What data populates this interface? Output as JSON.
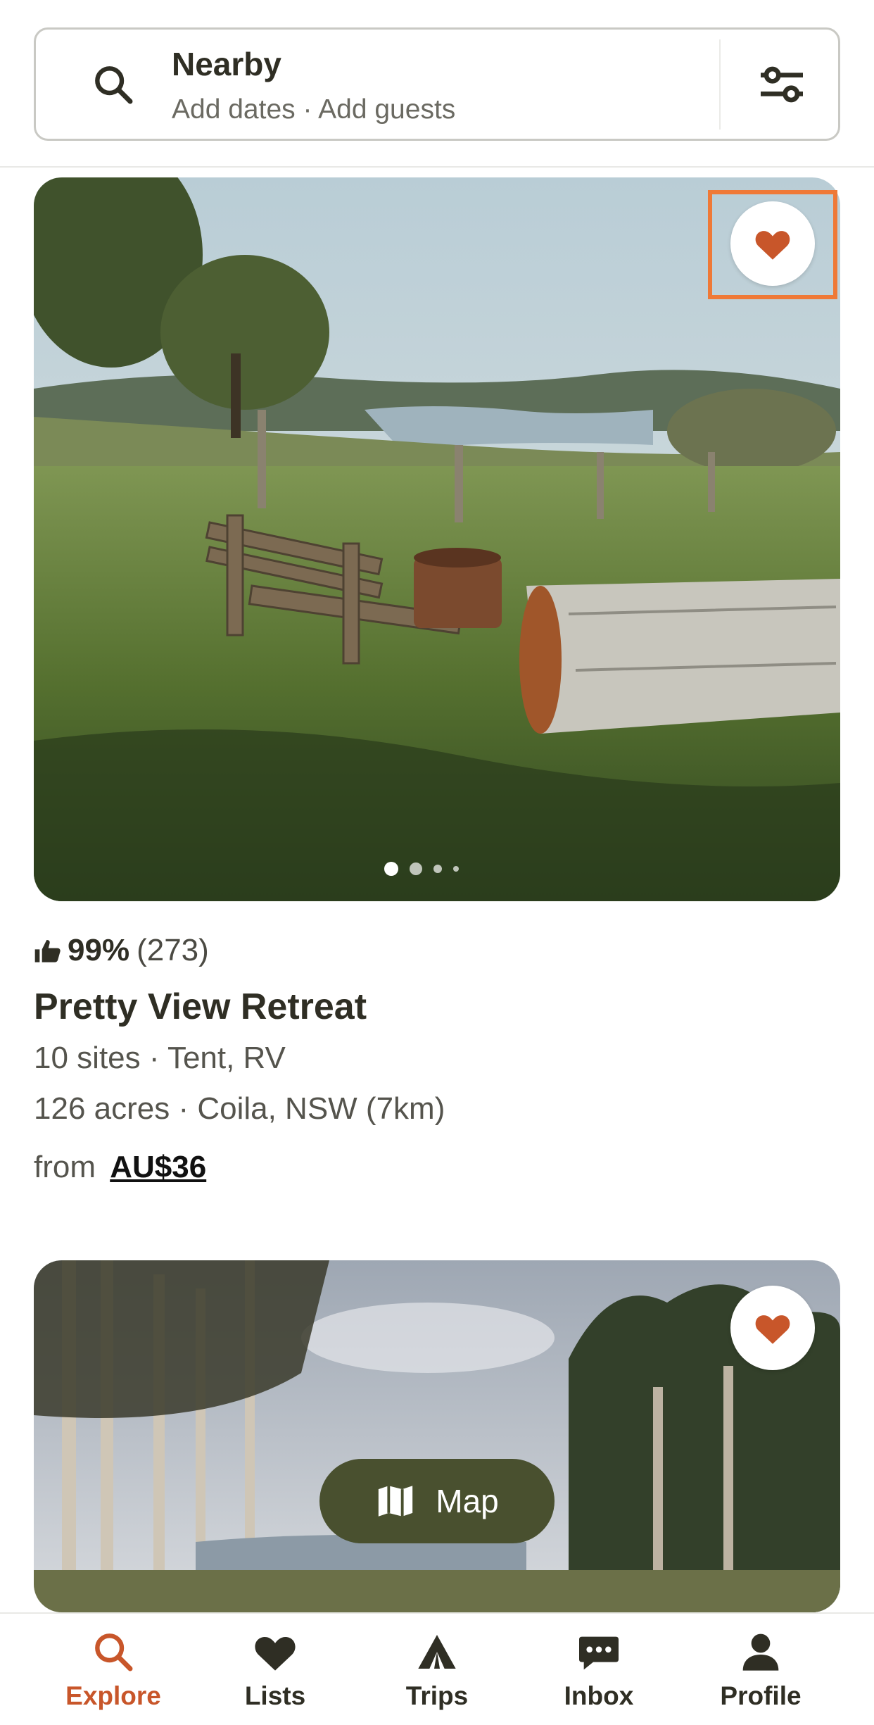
{
  "search": {
    "title": "Nearby",
    "subtitle": "Add dates · Add guests"
  },
  "listing1": {
    "rating_percent": "99%",
    "rating_count": "(273)",
    "title": "Pretty View Retreat",
    "details_line1": "10 sites · Tent, RV",
    "details_line2": "126 acres · Coila, NSW (7km)",
    "price_prefix": "from",
    "price": "AU$36",
    "saved": true,
    "photo_count_dots": 4
  },
  "listing2": {
    "saved": true
  },
  "map_button": {
    "label": "Map"
  },
  "nav": {
    "items": [
      {
        "label": "Explore",
        "icon": "search-icon",
        "active": true
      },
      {
        "label": "Lists",
        "icon": "heart-icon",
        "active": false
      },
      {
        "label": "Trips",
        "icon": "tent-icon",
        "active": false
      },
      {
        "label": "Inbox",
        "icon": "chat-icon",
        "active": false
      },
      {
        "label": "Profile",
        "icon": "person-icon",
        "active": false
      }
    ]
  },
  "colors": {
    "accent": "#c8562a",
    "map_button": "#49502f",
    "highlight": "#ef7937"
  }
}
